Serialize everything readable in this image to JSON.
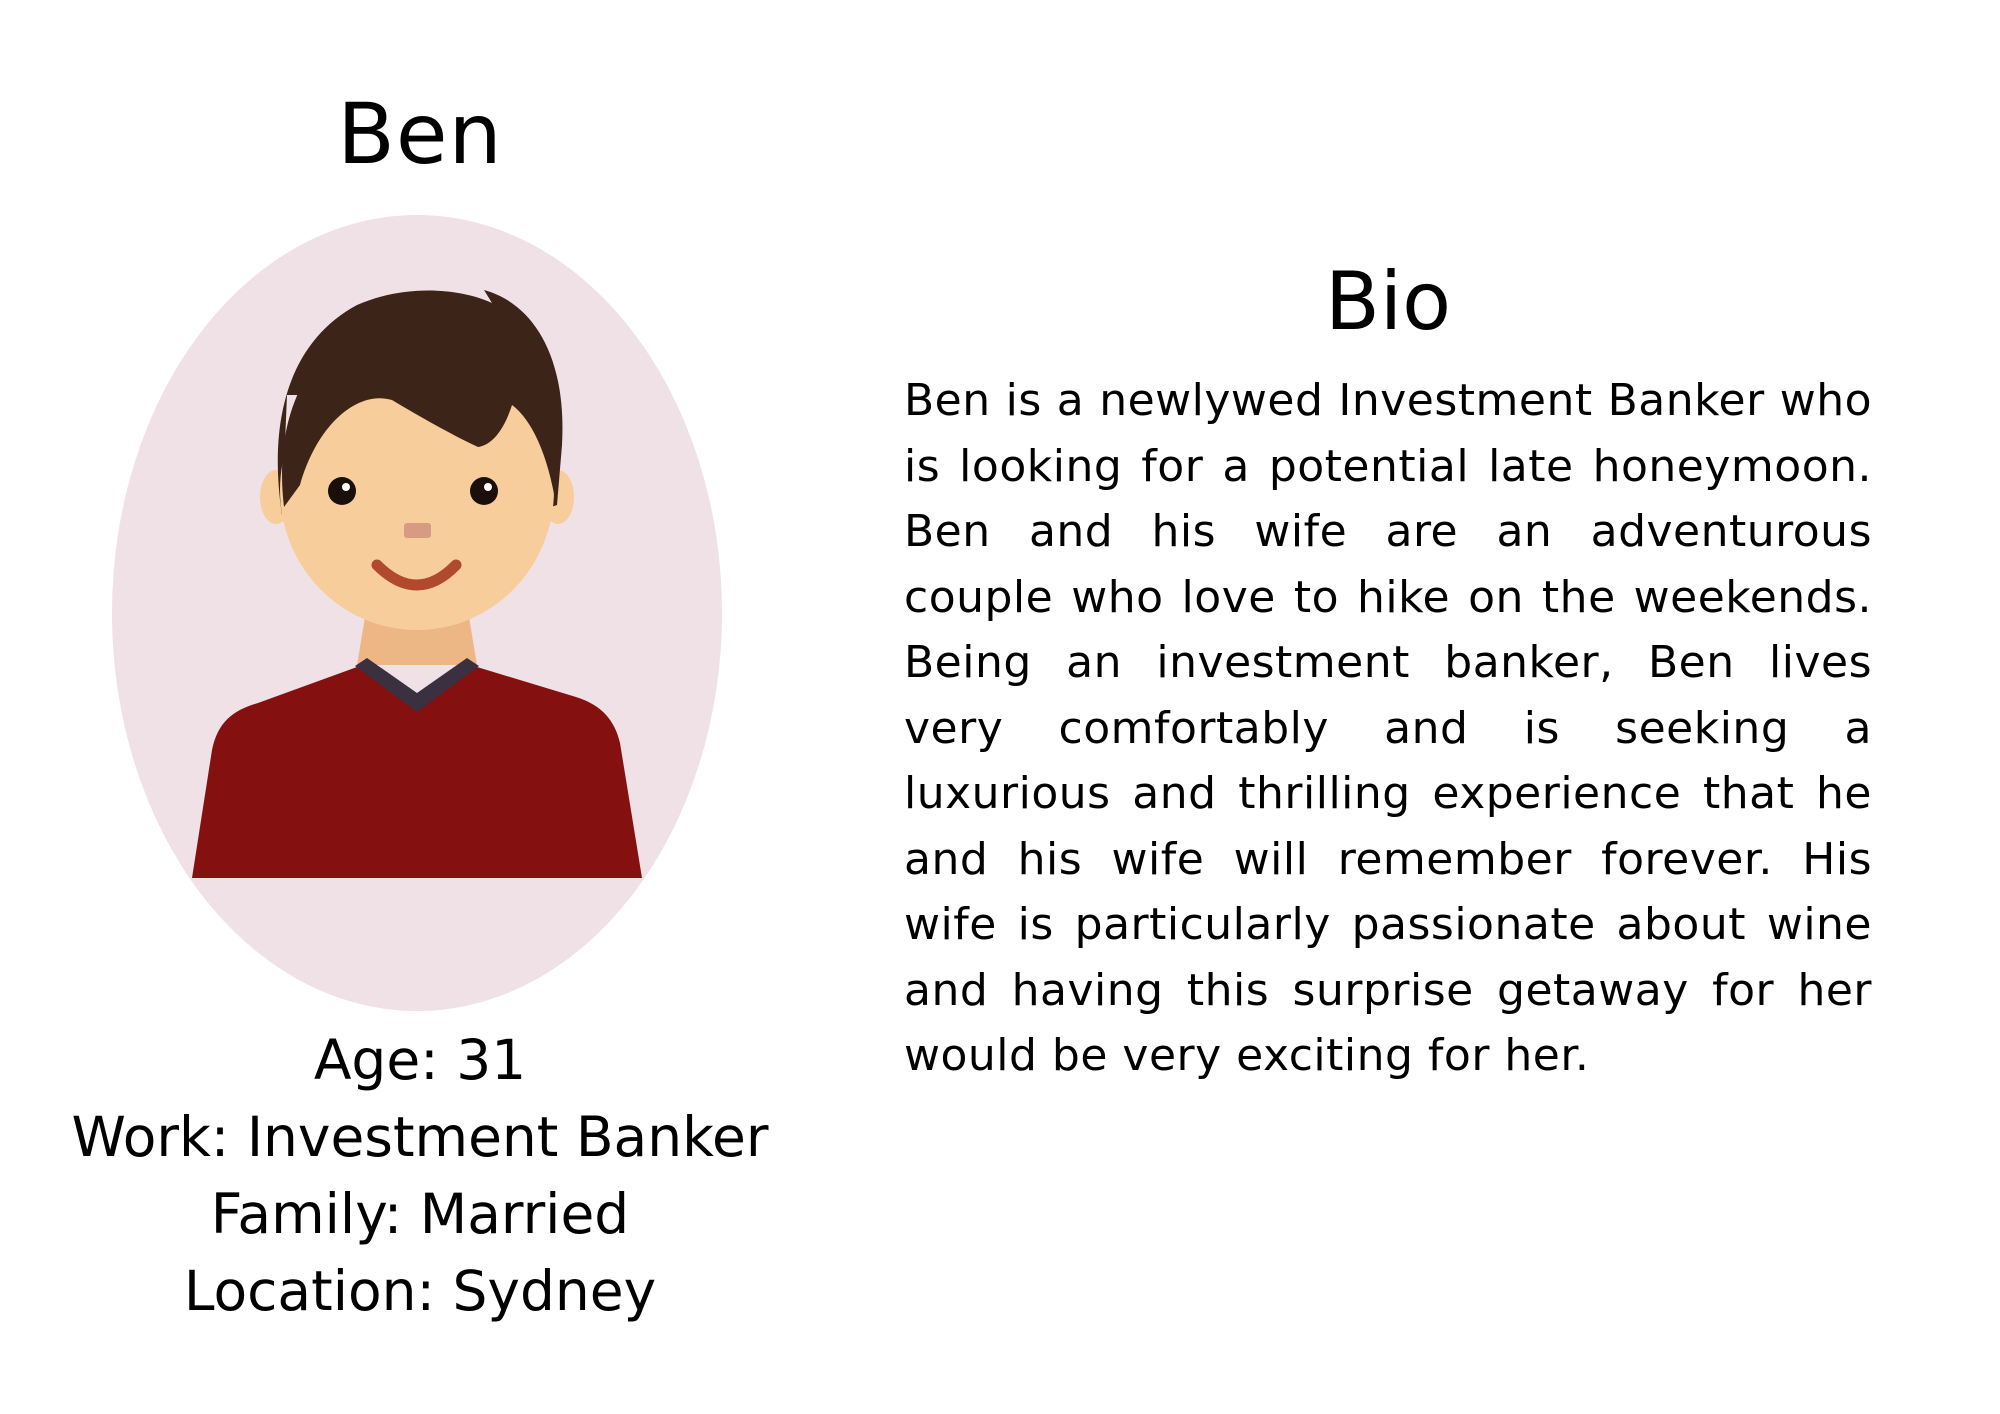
{
  "persona": {
    "name": "Ben",
    "details": {
      "age": "Age: 31",
      "work": "Work: Investment Banker",
      "family": "Family: Married",
      "location": "Location: Sydney"
    }
  },
  "bio": {
    "heading": "Bio",
    "text": "Ben is a newlywed Investment Banker who is looking for a potential late honeymoon. Ben and his wife are an adventurous couple who love to hike on the weekends. Being an investment banker, Ben lives very comfortably and is seeking a luxurious and thrilling experience that he and his wife will remember forever. His wife is particularly passionate about wine and having this surprise getaway for her would be very exciting for her."
  },
  "colors": {
    "avatar_background": "#efe1e6",
    "hair": "#3c2518",
    "skin": "#f8cd9c",
    "sweater": "#84100f",
    "collar": "#3a3040",
    "smile": "#b1492d"
  }
}
